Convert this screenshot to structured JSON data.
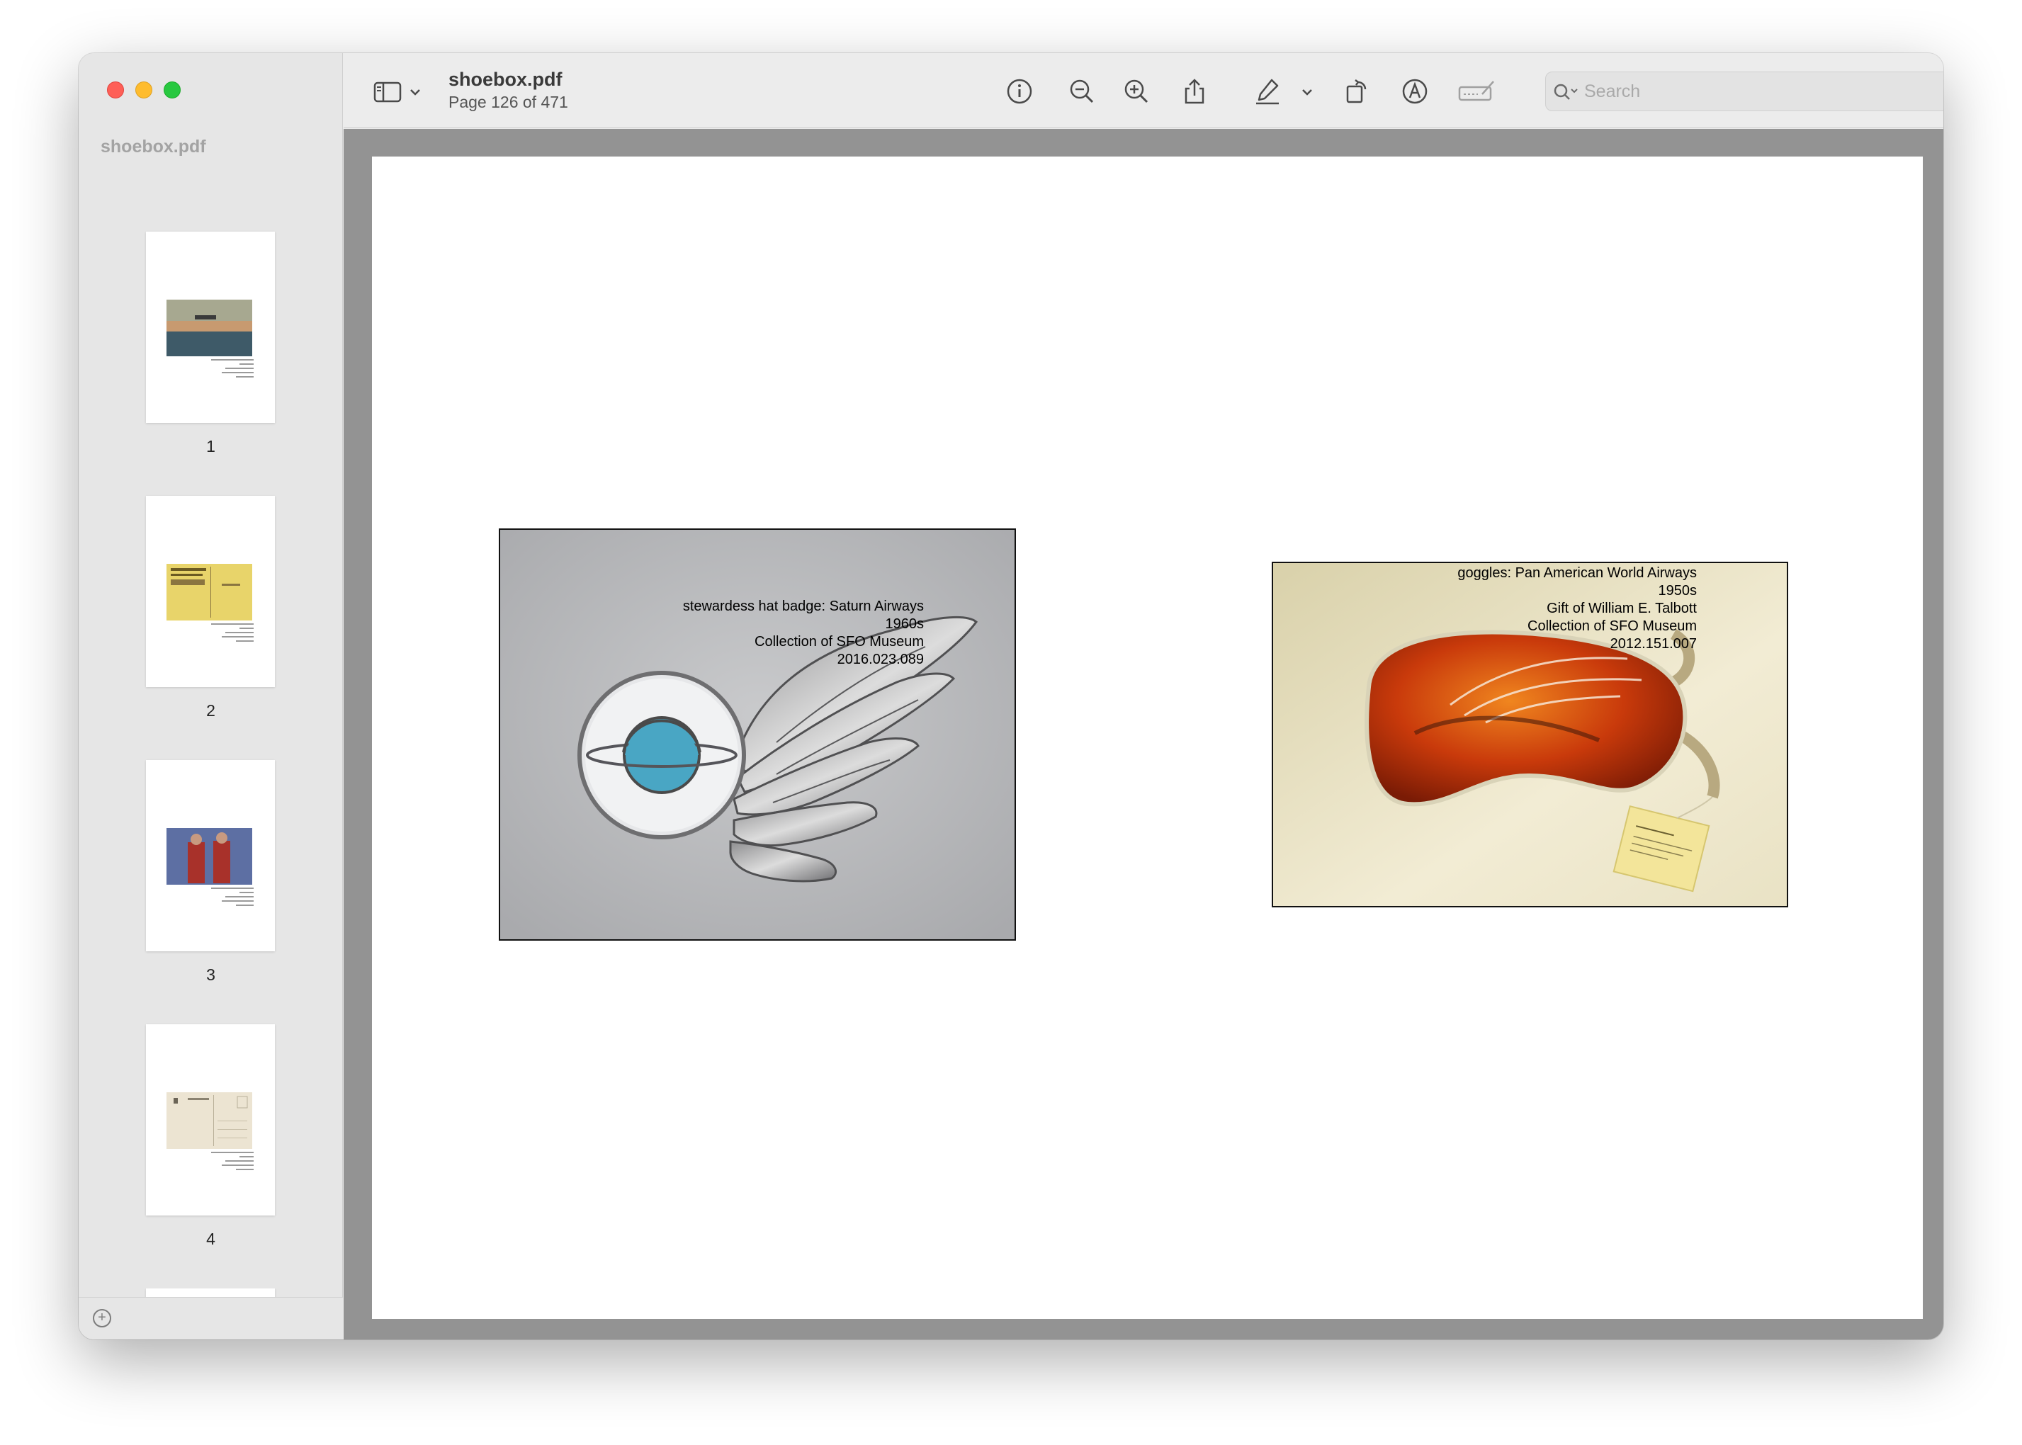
{
  "sidebar": {
    "title": "shoebox.pdf",
    "thumbnails": [
      {
        "page": "1"
      },
      {
        "page": "2"
      },
      {
        "page": "3"
      },
      {
        "page": "4"
      }
    ]
  },
  "toolbar": {
    "doc_title": "shoebox.pdf",
    "page_status": "Page 126 of 471",
    "search_placeholder": "Search"
  },
  "page": {
    "items": [
      {
        "image": "stewardess hat badge photo",
        "caption": [
          "stewardess hat badge: Saturn Airways",
          "1960s",
          "Collection of SFO Museum",
          "2016.023.089"
        ]
      },
      {
        "image": "goggles photo",
        "caption": [
          "goggles: Pan American World Airways",
          "1950s",
          "Gift of William E. Talbott",
          "Collection of SFO Museum",
          "2012.151.007"
        ]
      }
    ]
  },
  "colors": {
    "close": "#fe5f57",
    "minimize": "#febc2e",
    "zoom": "#28c840",
    "canvas_background": "#939393"
  }
}
